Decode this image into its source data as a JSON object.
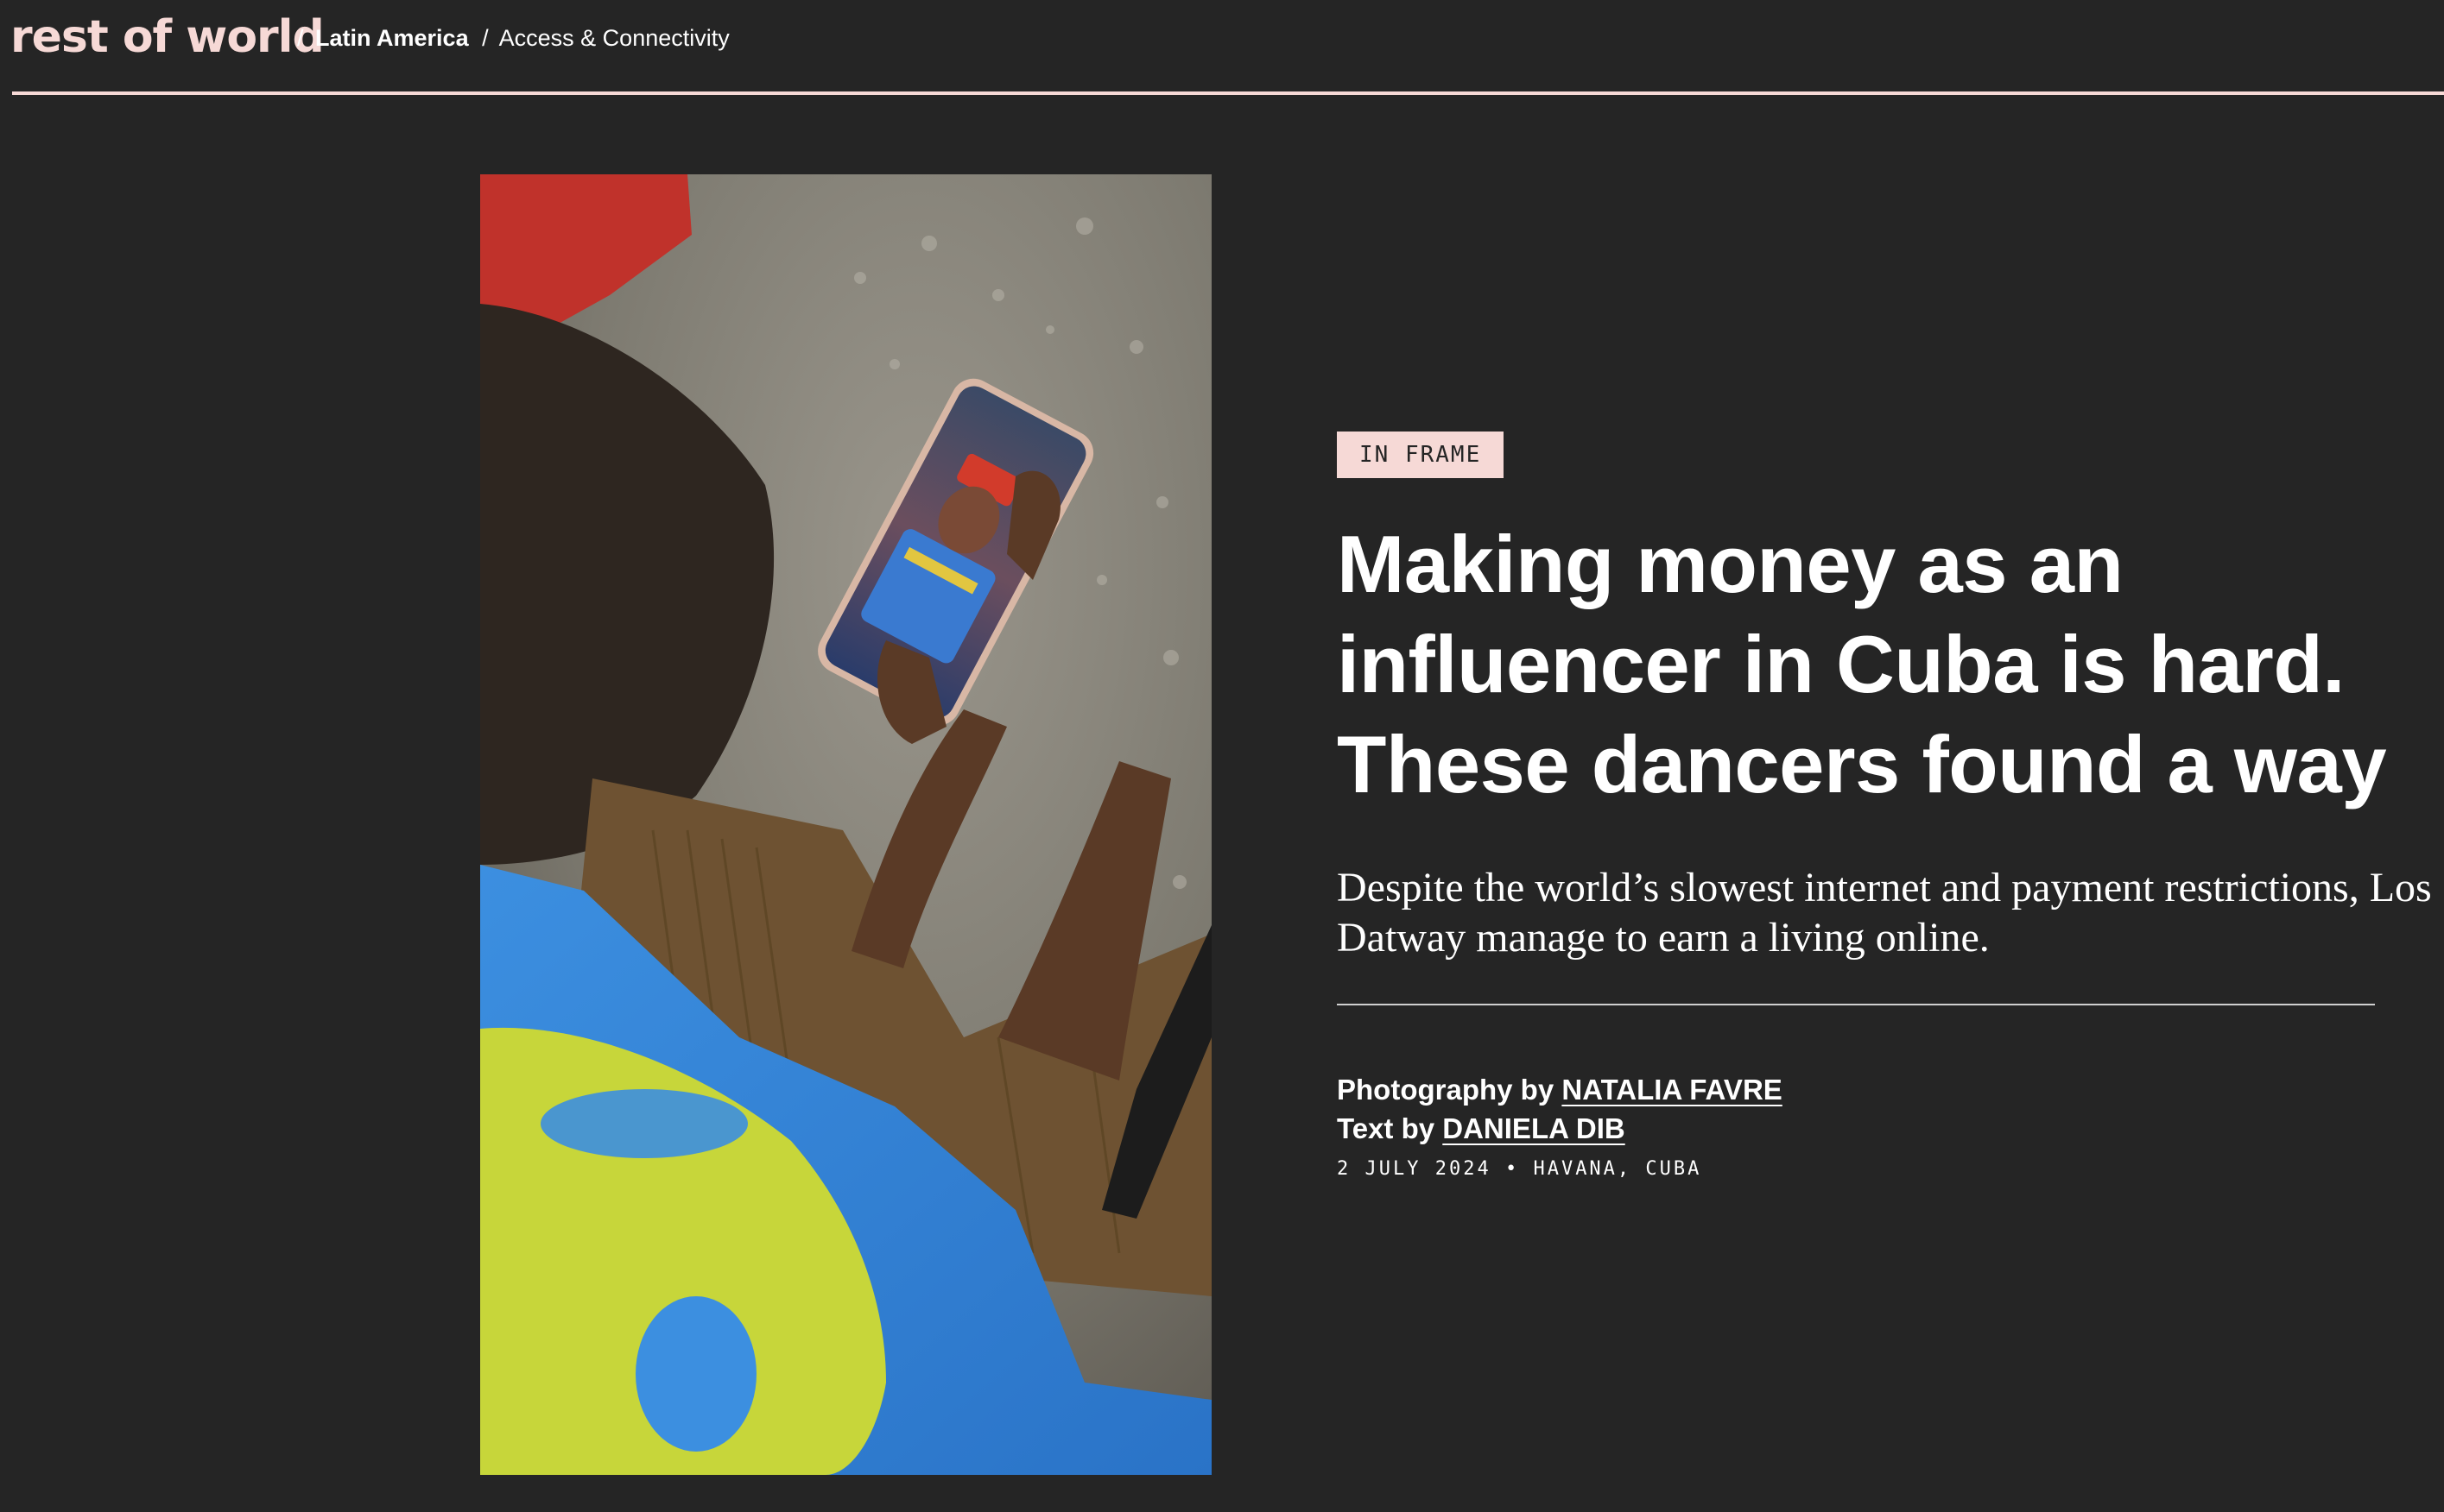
{
  "header": {
    "logo_text": "rest of world",
    "breadcrumb": {
      "separator": "/",
      "section": "Latin America",
      "topic": "Access & Connectivity"
    }
  },
  "hero": {
    "image_icon": "photo-image"
  },
  "article": {
    "label": "IN FRAME",
    "headline": "Making money as an influencer in Cuba is hard. These dancers found a way",
    "dek": "Despite the world’s slowest internet and payment restrictions, Los Datway manage to earn a living online.",
    "credits": {
      "photography_prefix": "Photography by",
      "photographer": "NATALIA FAVRE",
      "text_prefix": "Text by",
      "writer": "DANIELA DIB"
    },
    "dateline": {
      "date": "2 JULY 2024",
      "bullet": "•",
      "location": "HAVANA, CUBA"
    }
  },
  "colors": {
    "background": "#252525",
    "accent_pink": "#f6d9d6",
    "text": "#ffffff"
  }
}
